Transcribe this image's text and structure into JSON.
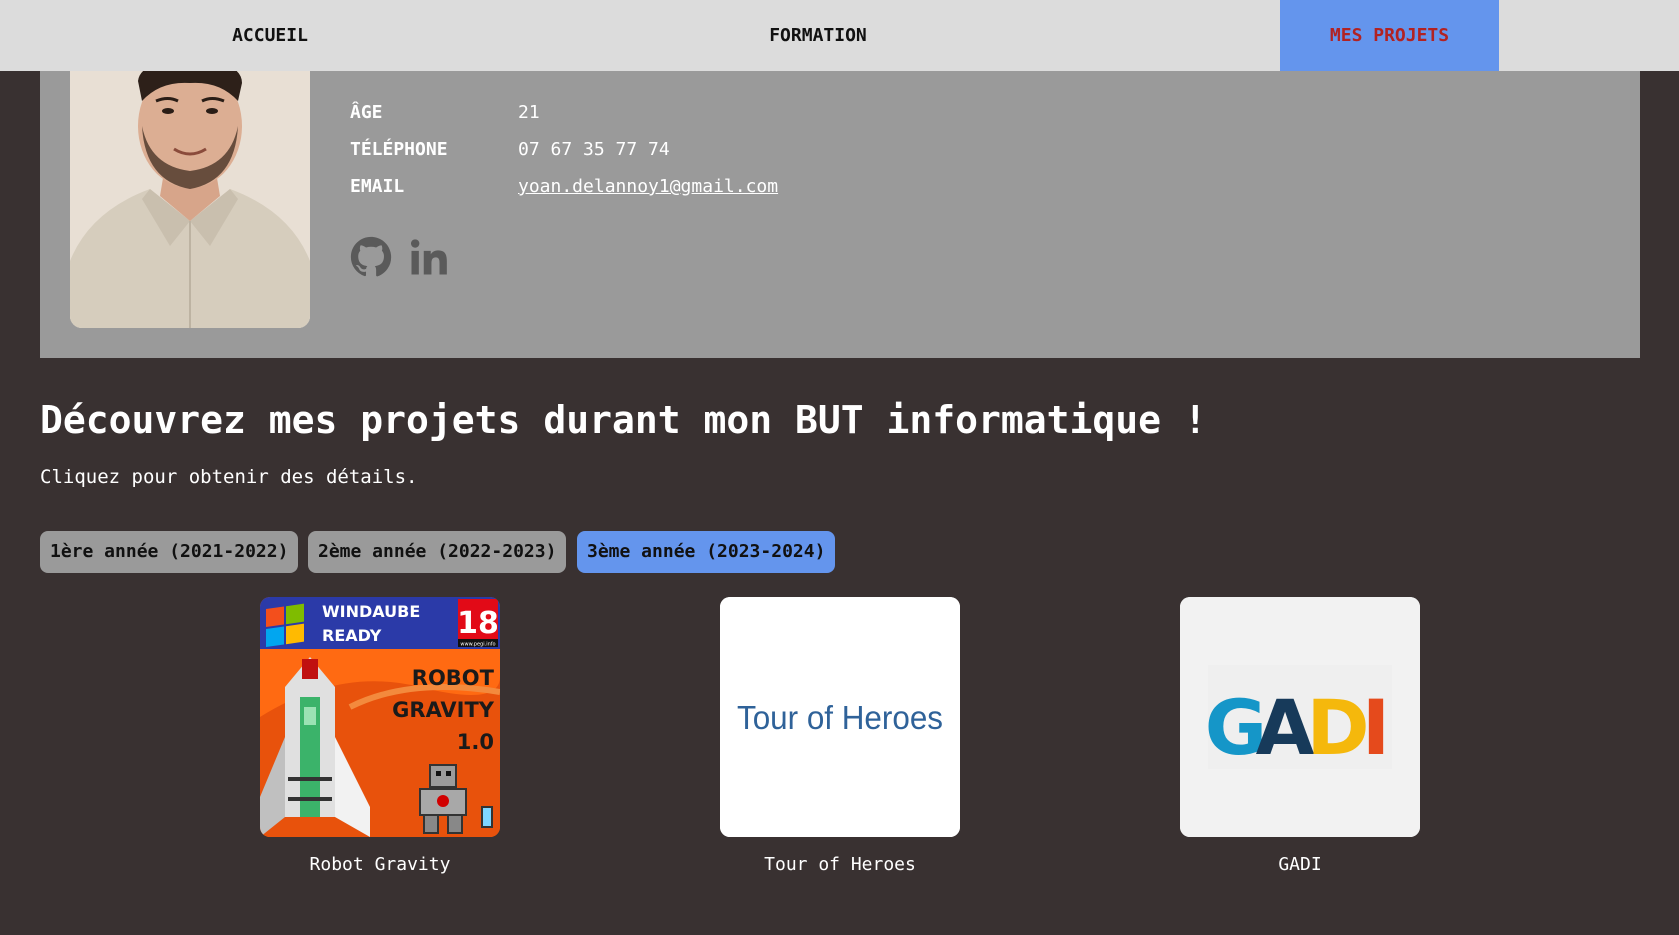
{
  "nav": {
    "items": [
      {
        "label": "ACCUEIL"
      },
      {
        "label": "FORMATION"
      },
      {
        "label": "MES PROJETS",
        "active": true
      }
    ]
  },
  "profile": {
    "age_label": "ÂGE",
    "age_value": "21",
    "phone_label": "TÉLÉPHONE",
    "phone_value": "07 67 35 77 74",
    "email_label": "EMAIL",
    "email_value": "yoan.delannoy1@gmail.com",
    "socials": [
      {
        "icon": "github-icon"
      },
      {
        "icon": "linkedin-icon"
      }
    ]
  },
  "projects_section": {
    "heading": "Découvrez mes projets durant mon BUT informatique !",
    "subtext": "Cliquez pour obtenir des détails.",
    "tabs": [
      {
        "label": "1ère année (2021-2022)"
      },
      {
        "label": "2ème année (2022-2023)"
      },
      {
        "label": "3ème année (2023-2024)",
        "active": true
      }
    ],
    "projects": [
      {
        "name": "Robot Gravity",
        "cover": {
          "brand_line1": "WINDAUBE",
          "brand_line2": "READY",
          "rating": "18",
          "rating_url": "www.pegi.info",
          "title_line1": "ROBOT",
          "title_line2": "GRAVITY",
          "version": "1.0"
        }
      },
      {
        "name": "Tour of Heroes",
        "cover": {
          "text": "Tour of Heroes"
        }
      },
      {
        "name": "GADI",
        "cover": {
          "letters": [
            "G",
            "A",
            "D",
            "I"
          ]
        }
      }
    ]
  },
  "colors": {
    "background": "#393131",
    "nav_bg": "#dcdcdc",
    "accent": "#6495ed",
    "active_nav_text": "#b22222",
    "card_bg": "#9a9a9a"
  }
}
